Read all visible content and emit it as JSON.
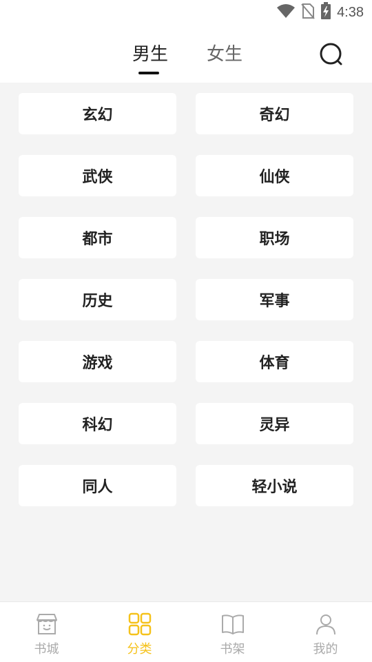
{
  "status": {
    "time": "4:38",
    "icons": [
      "wifi-icon",
      "no-sim-icon",
      "battery-charging-icon"
    ]
  },
  "tabs": [
    {
      "label": "男生",
      "active": true
    },
    {
      "label": "女生",
      "active": false
    }
  ],
  "search": {
    "icon": "search-icon"
  },
  "categories": [
    "玄幻",
    "奇幻",
    "武侠",
    "仙侠",
    "都市",
    "职场",
    "历史",
    "军事",
    "游戏",
    "体育",
    "科幻",
    "灵异",
    "同人",
    "轻小说"
  ],
  "bottom_nav": [
    {
      "label": "书城",
      "icon": "store-icon",
      "active": false
    },
    {
      "label": "分类",
      "icon": "grid-icon",
      "active": true
    },
    {
      "label": "书架",
      "icon": "book-icon",
      "active": false
    },
    {
      "label": "我的",
      "icon": "person-icon",
      "active": false
    }
  ],
  "colors": {
    "accent": "#f5c21b",
    "background": "#f4f4f4",
    "inactive": "#aaaaaa"
  }
}
